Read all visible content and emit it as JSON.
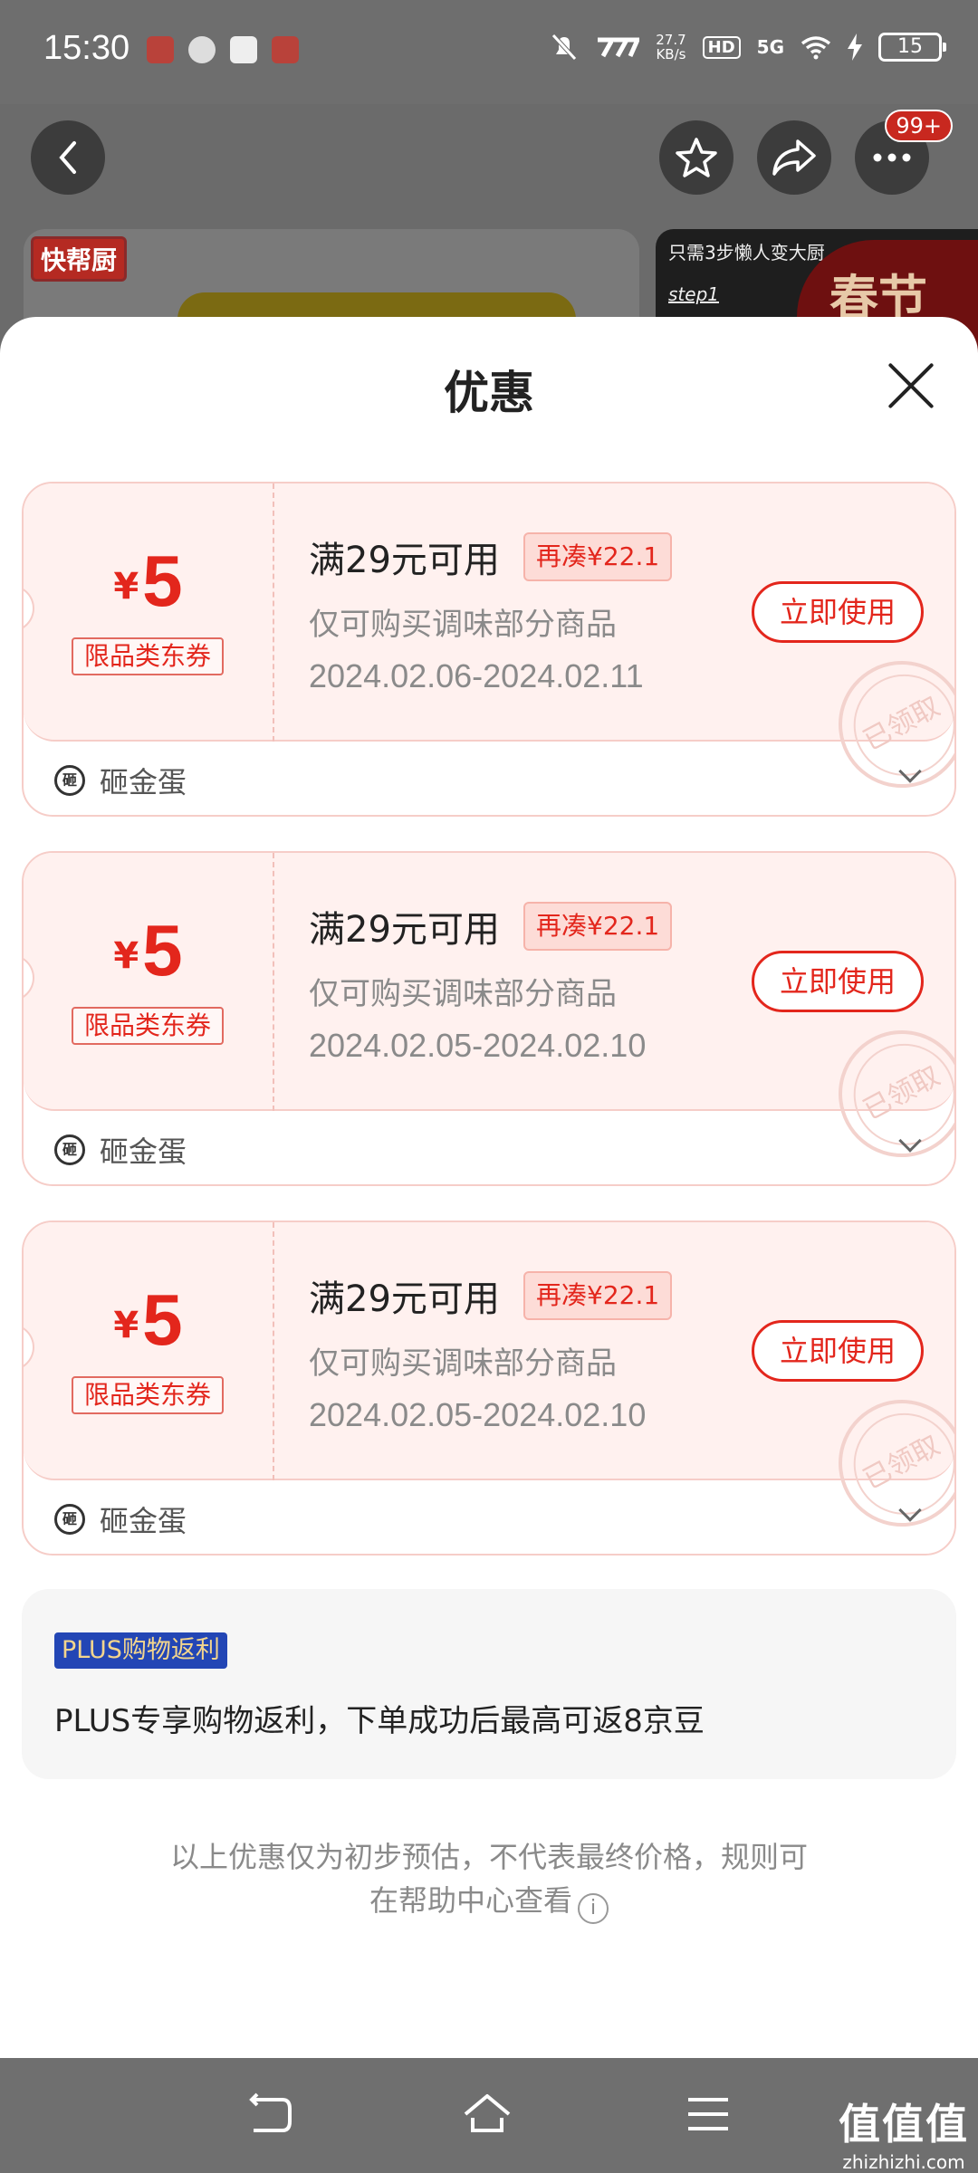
{
  "status_bar": {
    "time": "15:30",
    "net_speed_value": "27.7",
    "net_speed_unit": "KB/s",
    "hd_label": "HD",
    "network": "5G",
    "battery": "15"
  },
  "top_nav": {
    "more_badge": "99+"
  },
  "background_page": {
    "brand_tag": "快帮厨",
    "side_card_text": "只需3步懒人变大厨",
    "side_card_step": "step1",
    "festival_text": "春节"
  },
  "sheet": {
    "title": "优惠",
    "coupons": [
      {
        "currency": "¥",
        "amount": "5",
        "category": "限品类东券",
        "condition": "满29元可用",
        "more_needed": "再凑¥22.1",
        "scope": "仅可购买调味部分商品",
        "dates": "2024.02.06-2024.02.11",
        "use_label": "立即使用",
        "stamp": "已领取",
        "source_icon": "砸",
        "source_label": "砸金蛋"
      },
      {
        "currency": "¥",
        "amount": "5",
        "category": "限品类东券",
        "condition": "满29元可用",
        "more_needed": "再凑¥22.1",
        "scope": "仅可购买调味部分商品",
        "dates": "2024.02.05-2024.02.10",
        "use_label": "立即使用",
        "stamp": "已领取",
        "source_icon": "砸",
        "source_label": "砸金蛋"
      },
      {
        "currency": "¥",
        "amount": "5",
        "category": "限品类东券",
        "condition": "满29元可用",
        "more_needed": "再凑¥22.1",
        "scope": "仅可购买调味部分商品",
        "dates": "2024.02.05-2024.02.10",
        "use_label": "立即使用",
        "stamp": "已领取",
        "source_icon": "砸",
        "source_label": "砸金蛋"
      }
    ],
    "plus": {
      "tag": "PLUS购物返利",
      "text": "PLUS专享购物返利，下单成功后最高可返8京豆"
    },
    "disclaimer_line1": "以上优惠仅为初步预估，不代表最终价格，规则可",
    "disclaimer_line2": "在帮助中心查看",
    "info_icon": "i"
  },
  "watermark": {
    "logo": "值值值",
    "site": "zhizhizhi.com"
  },
  "colors": {
    "accent": "#e3261c",
    "coupon_bg": "#fff1ef",
    "plus_blue": "#2346b5"
  }
}
